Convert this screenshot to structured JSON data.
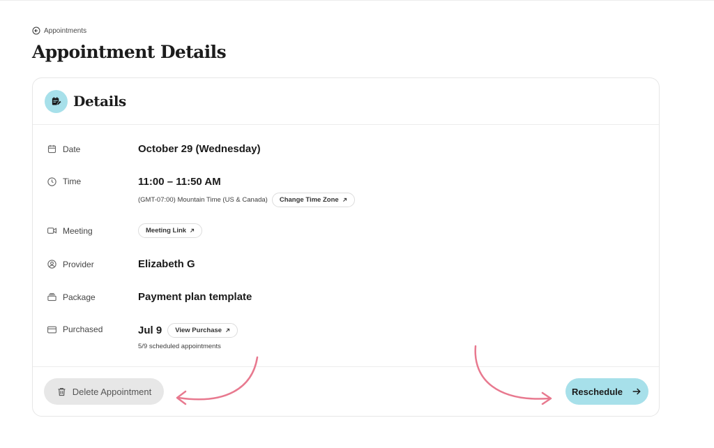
{
  "breadcrumb": {
    "label": "Appointments",
    "icon": "arrow-left-circle-icon"
  },
  "page": {
    "title": "Appointment Details"
  },
  "card": {
    "title": "Details",
    "icon": "calendar-edit-icon",
    "accent": "#a7e0ea"
  },
  "rows": {
    "date": {
      "label": "Date",
      "value": "October 29 (Wednesday)"
    },
    "time": {
      "label": "Time",
      "value": "11:00 – 11:50 AM",
      "timezone": "(GMT-07:00) Mountain Time (US & Canada)",
      "change_tz": "Change Time Zone"
    },
    "meeting": {
      "label": "Meeting",
      "link": "Meeting Link"
    },
    "provider": {
      "label": "Provider",
      "value": "Elizabeth G"
    },
    "package": {
      "label": "Package",
      "value": "Payment plan template"
    },
    "purchased": {
      "label": "Purchased",
      "value": "Jul 9",
      "view": "View Purchase",
      "scheduled": "5/9 scheduled appointments"
    }
  },
  "actions": {
    "delete": "Delete Appointment",
    "reschedule": "Reschedule"
  },
  "colors": {
    "accent": "#a7e0ea",
    "annotation_arrow": "#e8798f",
    "delete_bg": "#e7e7e7"
  }
}
